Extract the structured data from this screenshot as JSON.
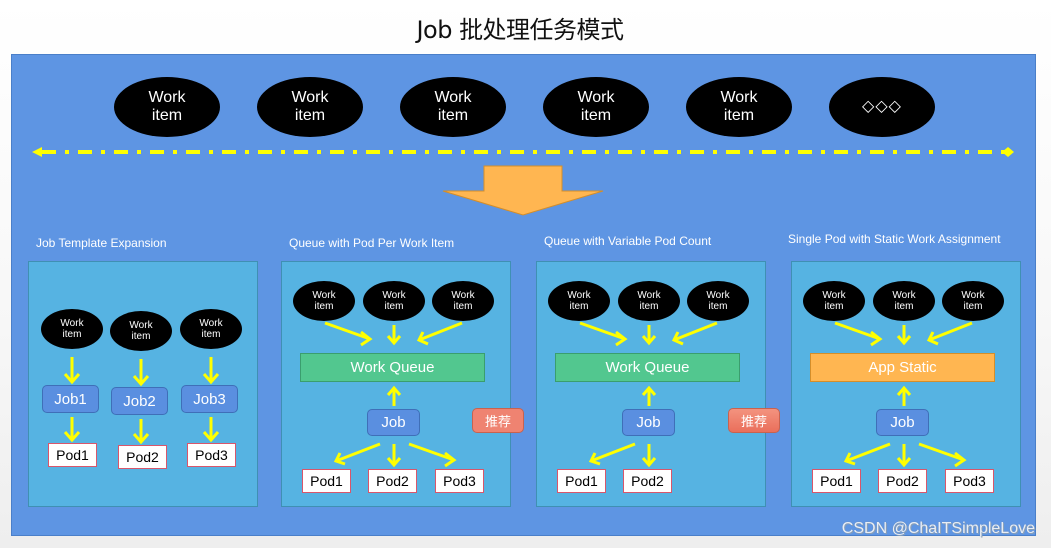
{
  "title": "Job 批处理任务模式",
  "top_row": {
    "items": [
      {
        "label": "Work\nitem"
      },
      {
        "label": "Work\nitem"
      },
      {
        "label": "Work\nitem"
      },
      {
        "label": "Work\nitem"
      },
      {
        "label": "Work\nitem"
      },
      {
        "label": "◇◇◇"
      }
    ]
  },
  "colors": {
    "stage_bg": "#5e95e3",
    "panel_bg": "#56b3e2",
    "arrow_yellow": "#ffff00",
    "big_arrow": "#ffb651",
    "queue_green": "#52c78f",
    "static_orange": "#ffb651",
    "job_blue": "#5a8fe0",
    "badge_red": "#ef8371",
    "pod_border": "#d9566b"
  },
  "patterns": [
    {
      "label": "Job Template Expansion",
      "work_items": [
        "Work\nitem",
        "Work\nitem",
        "Work\nitem"
      ],
      "jobs": [
        "Job1",
        "Job2",
        "Job3"
      ],
      "pods": [
        "Pod1",
        "Pod2",
        "Pod3"
      ]
    },
    {
      "label": "Queue with Pod Per Work Item",
      "work_items": [
        "Work\nitem",
        "Work\nitem",
        "Work\nitem"
      ],
      "queue": "Work Queue",
      "job": "Job",
      "pods": [
        "Pod1",
        "Pod2",
        "Pod3"
      ],
      "badge": "推荐"
    },
    {
      "label": "Queue with Variable Pod Count",
      "work_items": [
        "Work\nitem",
        "Work\nitem",
        "Work\nitem"
      ],
      "queue": "Work Queue",
      "job": "Job",
      "pods": [
        "Pod1",
        "Pod2"
      ],
      "badge": "推荐"
    },
    {
      "label": "Single Pod with Static Work Assignment",
      "work_items": [
        "Work\nitem",
        "Work\nitem",
        "Work\nitem"
      ],
      "queue": "App Static",
      "job": "Job",
      "pods": [
        "Pod1",
        "Pod2",
        "Pod3"
      ]
    }
  ],
  "watermark": "CSDN @ChaITSimpleLove"
}
